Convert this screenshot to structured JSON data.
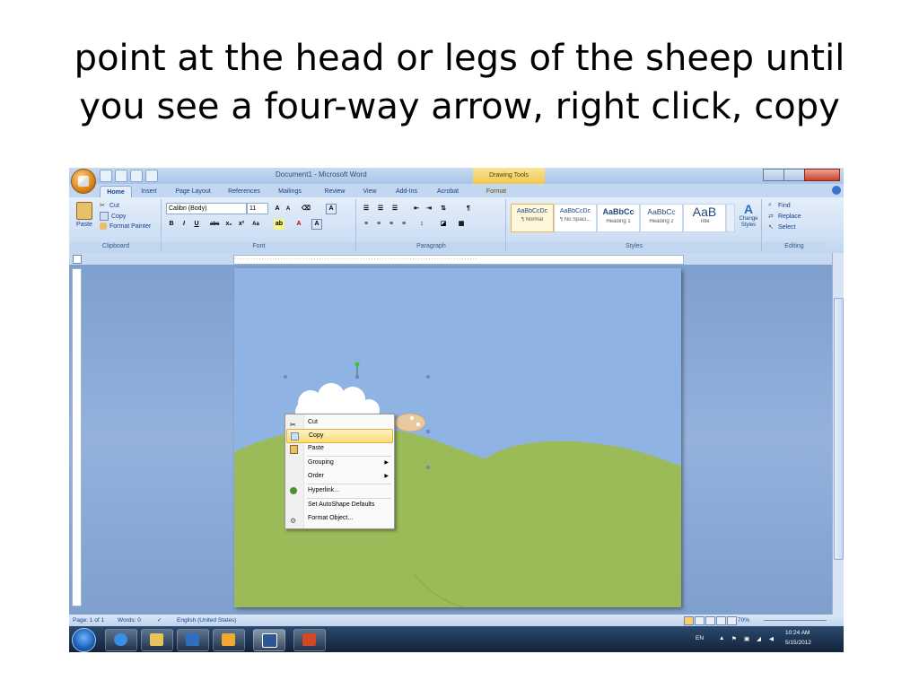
{
  "slide": {
    "title_line1": "point at the head or legs of the sheep until",
    "title_line2": "you see a four-way arrow, right click, copy"
  },
  "window": {
    "title": "Document1 - Microsoft Word",
    "contextual_tab_group": "Drawing Tools"
  },
  "tabs": [
    {
      "label": "Home",
      "active": true
    },
    {
      "label": "Insert"
    },
    {
      "label": "Page Layout"
    },
    {
      "label": "References"
    },
    {
      "label": "Mailings"
    },
    {
      "label": "Review"
    },
    {
      "label": "View"
    },
    {
      "label": "Add-Ins"
    },
    {
      "label": "Acrobat"
    },
    {
      "label": "Format"
    }
  ],
  "ribbon": {
    "clipboard": {
      "paste": "Paste",
      "cut": "Cut",
      "copy": "Copy",
      "format_painter": "Format Painter",
      "label": "Clipboard"
    },
    "font": {
      "name": "Calibri (Body)",
      "size": "11",
      "label": "Font"
    },
    "paragraph": {
      "label": "Paragraph"
    },
    "styles": {
      "items": [
        {
          "preview": "AaBbCcDc",
          "name": "¶ Normal"
        },
        {
          "preview": "AaBbCcDc",
          "name": "¶ No Spaci..."
        },
        {
          "preview": "AaBbCc",
          "name": "Heading 1"
        },
        {
          "preview": "AaBbCc",
          "name": "Heading 2"
        },
        {
          "preview": "AaB",
          "name": "Title"
        }
      ],
      "change_styles": "Change Styles",
      "label": "Styles"
    },
    "editing": {
      "find": "Find",
      "replace": "Replace",
      "select": "Select",
      "label": "Editing"
    }
  },
  "context_menu": {
    "items": [
      {
        "label": "Cut",
        "icon": "scissors-icon"
      },
      {
        "label": "Copy",
        "icon": "copy-icon",
        "highlighted": true
      },
      {
        "label": "Paste",
        "icon": "paste-icon"
      },
      {
        "label": "Grouping",
        "submenu": true
      },
      {
        "label": "Order",
        "submenu": true
      },
      {
        "label": "Hyperlink...",
        "icon": "hyperlink-icon"
      },
      {
        "label": "Set AutoShape Defaults"
      },
      {
        "label": "Format Object...",
        "icon": "format-object-icon"
      }
    ]
  },
  "status_bar": {
    "page": "Page: 1 of 1",
    "words": "Words: 0",
    "language": "English (United States)",
    "zoom": "70%"
  },
  "taskbar": {
    "language": "EN",
    "time": "10:24 AM",
    "date": "5/15/2012"
  },
  "colors": {
    "sky": "#8fb4e3",
    "grass": "#9bbb59",
    "ribbon": "#dbe7f6",
    "menu_highlight": "#fbdb74"
  }
}
